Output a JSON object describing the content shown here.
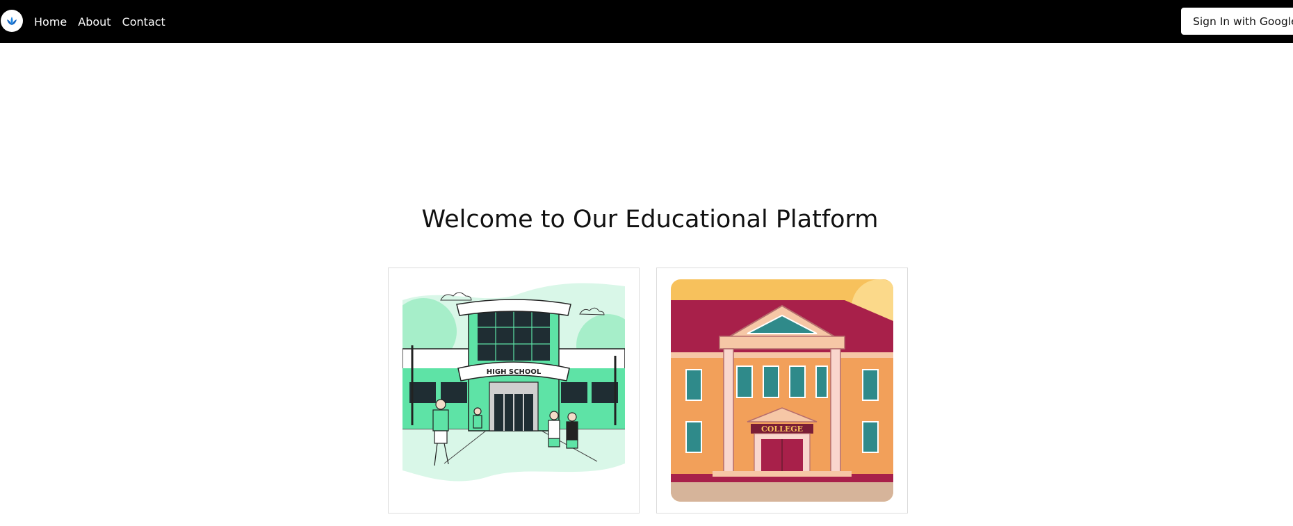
{
  "nav": {
    "logo_icon": "lotus-logo-icon",
    "links": [
      "Home",
      "About",
      "Contact"
    ],
    "signin_label": "Sign In with Google"
  },
  "main": {
    "heading": "Welcome to Our Educational Platform",
    "cards": [
      {
        "image": "high-school-illustration",
        "sign_text": "HIGH SCHOOL"
      },
      {
        "image": "college-building-illustration",
        "sign_text": "COLLEGE"
      }
    ]
  },
  "colors": {
    "navbar": "#000000",
    "school_green": "#5ee3a6",
    "college_orange": "#f2a05a",
    "college_roof": "#a8204a"
  }
}
